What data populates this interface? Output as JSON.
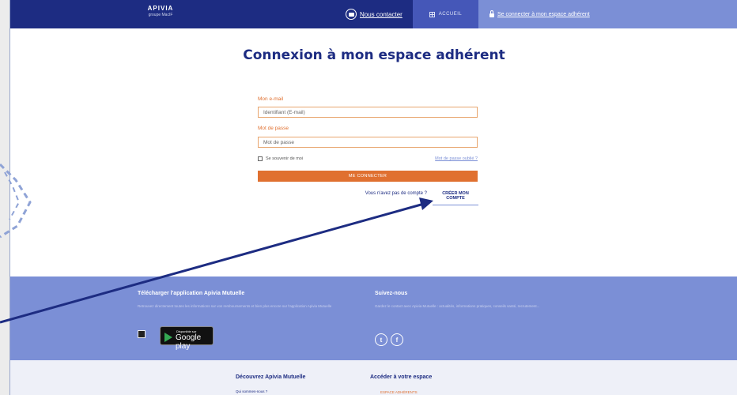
{
  "header": {
    "logo_main": "APIVIA",
    "logo_sub": "groupe MacIF",
    "contact_label": "Nous contacter",
    "home_label": "ACCUEIL",
    "login_link_label": "Se connecter à mon espace adhérent"
  },
  "login": {
    "title": "Connexion à mon espace adhérent",
    "email_label": "Mon e-mail",
    "email_placeholder": "Identifiant (E-mail)",
    "password_label": "Mot de passe",
    "password_placeholder": "Mot de passe",
    "remember_label": "Se souvenir de moi",
    "forgot_label": "Mot de passe oublié ?",
    "submit_label": "ME CONNECTER",
    "no_account_text": "Vous n'avez pas de compte ?",
    "create_account_label": "CRÉER MON COMPTE"
  },
  "footer_app": {
    "title": "Télécharger l'application Apivia Mutuelle",
    "text": "Retrouvez directement toutes les informations sur vos remboursements et bien plus encore sur l'application Apivia Mutuelle",
    "gplay_small": "Disponible sur",
    "gplay_big": "Google play"
  },
  "footer_social": {
    "title": "Suivez-nous",
    "text": "Gardez le contact avec Apivia Mutuelle : actualités, informations pratiques, conseils santé, recrutement...",
    "twitter_glyph": "t",
    "facebook_glyph": "f"
  },
  "footer_links": {
    "discover_title": "Découvrez Apivia Mutuelle",
    "who_link": "Qui sommes-nous ?",
    "access_title": "Accéder à votre espace",
    "access_item": "ESPACE ADHÉRENTS"
  },
  "colors": {
    "navy": "#1d2c82",
    "periwinkle": "#7b8fd6",
    "orange": "#e07030"
  }
}
